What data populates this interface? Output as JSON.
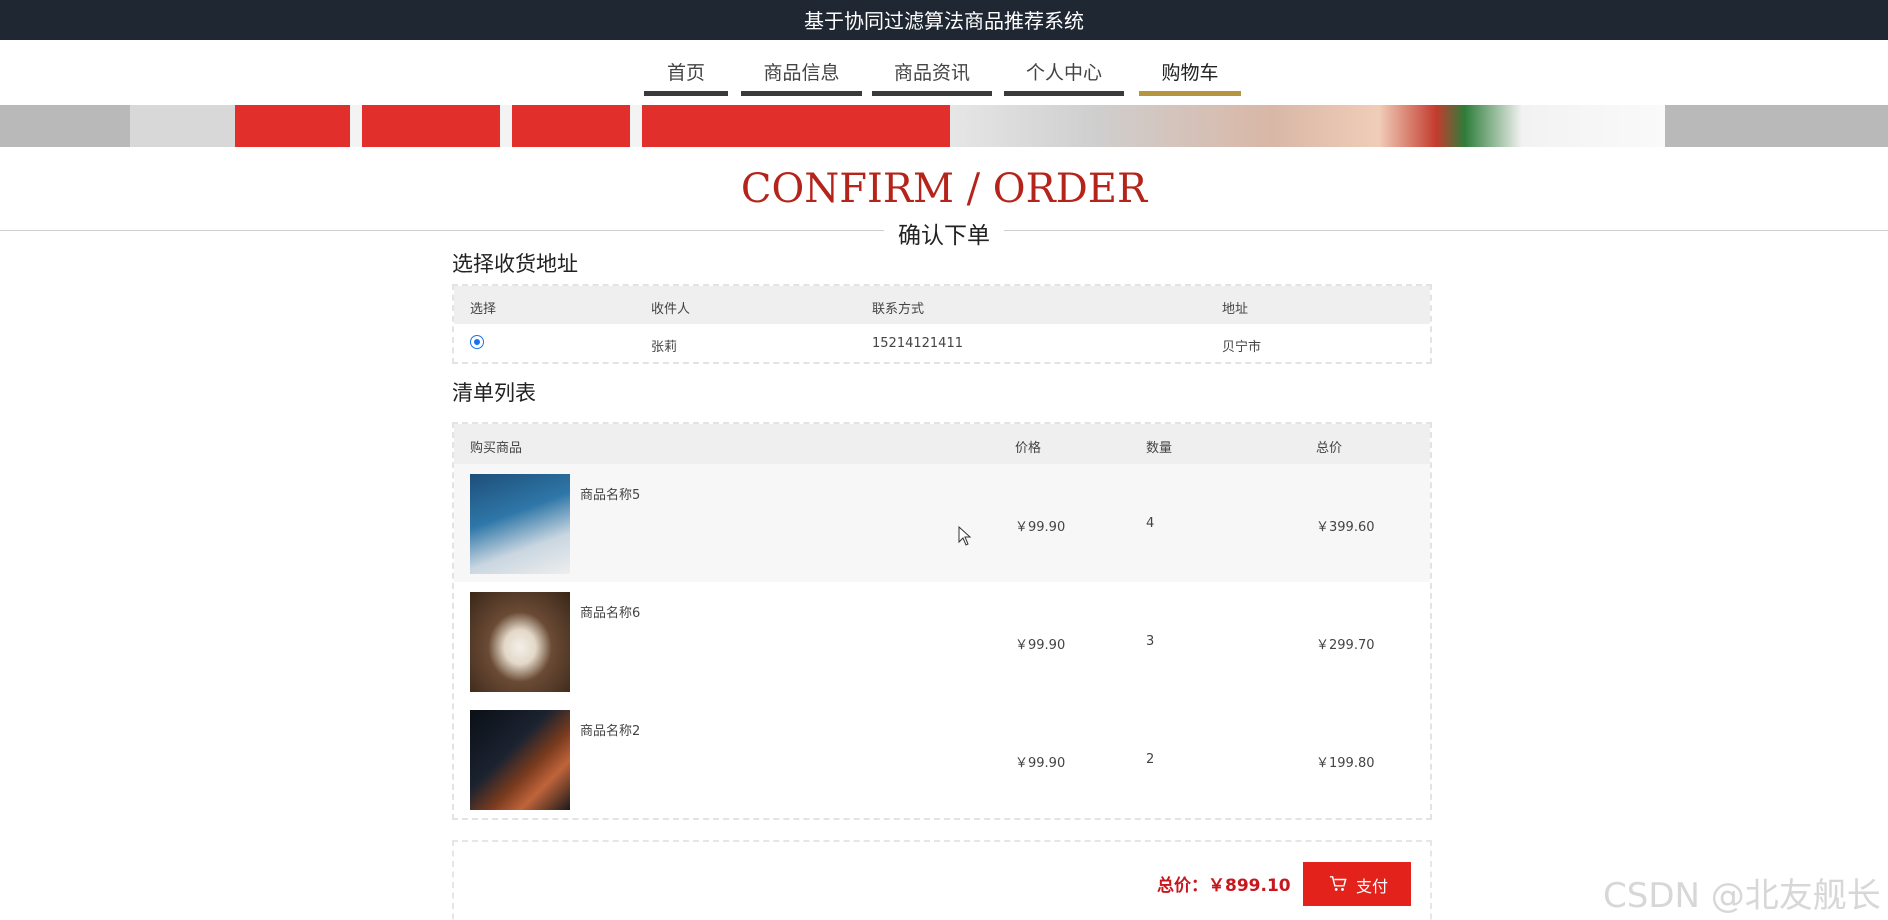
{
  "header": {
    "title": "基于协同过滤算法商品推荐系统"
  },
  "nav": {
    "items": [
      {
        "label": "首页"
      },
      {
        "label": "商品信息"
      },
      {
        "label": "商品资讯"
      },
      {
        "label": "个人中心"
      },
      {
        "label": "购物车",
        "active": true
      }
    ]
  },
  "page": {
    "title_en": "CONFIRM / ORDER",
    "title_cn": "确认下单"
  },
  "address": {
    "section_title": "选择收货地址",
    "columns": [
      "选择",
      "收件人",
      "联系方式",
      "地址"
    ],
    "rows": [
      {
        "selected": true,
        "recipient": "张莉",
        "phone": "15214121411",
        "address": "贝宁市"
      }
    ]
  },
  "order": {
    "section_title": "清单列表",
    "columns": [
      "购买商品",
      "价格",
      "数量",
      "总价"
    ],
    "items": [
      {
        "name": "商品名称5",
        "price": "￥99.90",
        "qty": "4",
        "total": "￥399.60",
        "image": "laptop-image"
      },
      {
        "name": "商品名称6",
        "price": "￥99.90",
        "qty": "3",
        "total": "￥299.70",
        "image": "wedding-dress-image"
      },
      {
        "name": "商品名称2",
        "price": "￥99.90",
        "qty": "2",
        "total": "￥199.80",
        "image": "monitor-image"
      }
    ]
  },
  "summary": {
    "total_label": "总价：￥899.10",
    "pay_label": "支付"
  },
  "watermark": "CSDN @北友舰长",
  "colors": {
    "accent_red": "#c8161d",
    "nav_active": "#b5953e",
    "topbar": "#1f2733"
  }
}
